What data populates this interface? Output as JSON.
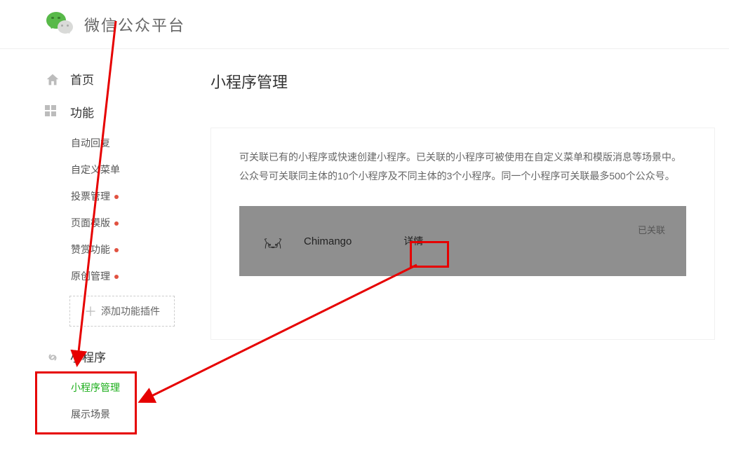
{
  "brand": "微信公众平台",
  "sidebar": {
    "home": "首页",
    "functions": "功能",
    "func_items": [
      {
        "label": "自动回复",
        "dot": false
      },
      {
        "label": "自定义菜单",
        "dot": false
      },
      {
        "label": "投票管理",
        "dot": true
      },
      {
        "label": "页面模版",
        "dot": true
      },
      {
        "label": "赞赏功能",
        "dot": true
      },
      {
        "label": "原创管理",
        "dot": true
      }
    ],
    "add_plugin": "添加功能插件",
    "miniprogram": "小程序",
    "mp_items": [
      {
        "label": "小程序管理",
        "active": true
      },
      {
        "label": "展示场景",
        "active": false
      }
    ]
  },
  "content": {
    "title": "小程序管理",
    "desc_line1": "可关联已有的小程序或快速创建小程序。已关联的小程序可被使用在自定义菜单和模版消息等场景中。",
    "desc_line2": "公众号可关联同主体的10个小程序及不同主体的3个小程序。同一个小程序可关联最多500个公众号。",
    "app": {
      "name": "Chimango",
      "detail": "详情",
      "status": "已关联"
    }
  }
}
